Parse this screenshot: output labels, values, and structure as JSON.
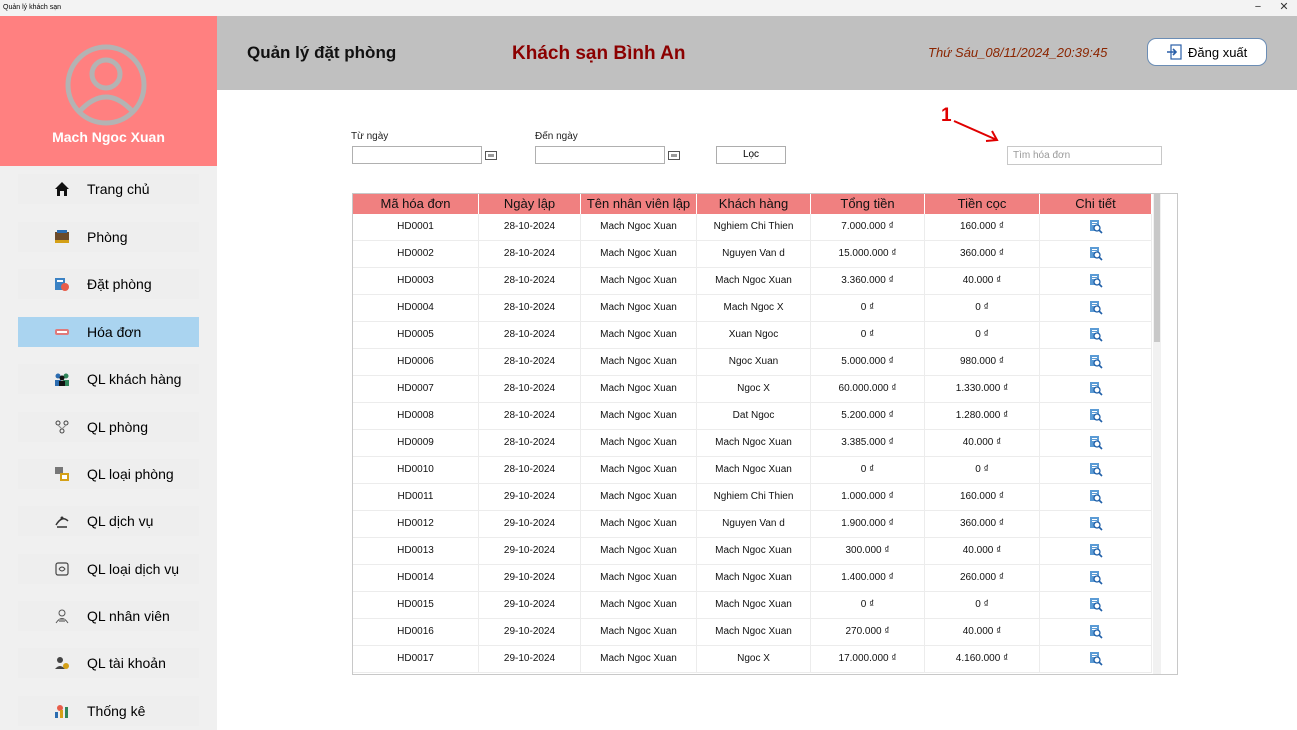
{
  "window": {
    "title": "Quản lý khách sạn",
    "minimize": "−",
    "close": "✕"
  },
  "sidebar": {
    "user_name": "Mach Ngoc Xuan",
    "items": [
      {
        "label": "Trang chủ",
        "icon": "home-icon"
      },
      {
        "label": "Phòng",
        "icon": "room-icon"
      },
      {
        "label": "Đặt phòng",
        "icon": "booking-icon"
      },
      {
        "label": "Hóa đơn",
        "icon": "invoice-icon",
        "active": true
      },
      {
        "label": "QL khách hàng",
        "icon": "customers-icon"
      },
      {
        "label": "QL phòng",
        "icon": "room-manage-icon"
      },
      {
        "label": "QL loại phòng",
        "icon": "room-type-icon"
      },
      {
        "label": "QL dịch vụ",
        "icon": "service-icon"
      },
      {
        "label": "QL loại dịch vụ",
        "icon": "service-type-icon"
      },
      {
        "label": "QL nhân viên",
        "icon": "staff-icon"
      },
      {
        "label": "QL tài khoản",
        "icon": "account-icon"
      },
      {
        "label": "Thống kê",
        "icon": "stats-icon"
      }
    ]
  },
  "header": {
    "title": "Quản lý đặt phòng",
    "hotel_name": "Khách sạn Bình An",
    "datetime": "Thứ Sáu_08/11/2024_20:39:45",
    "logout_label": "Đăng xuất"
  },
  "filter": {
    "from_label": "Từ ngày",
    "to_label": "Đến ngày",
    "from_value": "",
    "to_value": "",
    "filter_button": "Lọc",
    "search_placeholder": "Tìm hóa đơn",
    "annotation": "1"
  },
  "table": {
    "columns": [
      "Mã hóa đơn",
      "Ngày lập",
      "Tên nhân viên lập",
      "Khách hàng",
      "Tổng tiền",
      "Tiền cọc",
      "Chi tiết"
    ],
    "rows": [
      [
        "HD0001",
        "28-10-2024",
        "Mach Ngoc Xuan",
        "Nghiem Chi Thien",
        "7.000.000 ₫",
        "160.000 ₫"
      ],
      [
        "HD0002",
        "28-10-2024",
        "Mach Ngoc Xuan",
        "Nguyen Van d",
        "15.000.000 ₫",
        "360.000 ₫"
      ],
      [
        "HD0003",
        "28-10-2024",
        "Mach Ngoc Xuan",
        "Mach Ngoc Xuan",
        "3.360.000 ₫",
        "40.000 ₫"
      ],
      [
        "HD0004",
        "28-10-2024",
        "Mach Ngoc Xuan",
        "Mach Ngoc X",
        "0 ₫",
        "0 ₫"
      ],
      [
        "HD0005",
        "28-10-2024",
        "Mach Ngoc Xuan",
        "Xuan Ngoc",
        "0 ₫",
        "0 ₫"
      ],
      [
        "HD0006",
        "28-10-2024",
        "Mach Ngoc Xuan",
        "Ngoc Xuan",
        "5.000.000 ₫",
        "980.000 ₫"
      ],
      [
        "HD0007",
        "28-10-2024",
        "Mach Ngoc Xuan",
        "Ngoc X",
        "60.000.000 ₫",
        "1.330.000 ₫"
      ],
      [
        "HD0008",
        "28-10-2024",
        "Mach Ngoc Xuan",
        "Dat Ngoc",
        "5.200.000 ₫",
        "1.280.000 ₫"
      ],
      [
        "HD0009",
        "28-10-2024",
        "Mach Ngoc Xuan",
        "Mach Ngoc Xuan",
        "3.385.000 ₫",
        "40.000 ₫"
      ],
      [
        "HD0010",
        "28-10-2024",
        "Mach Ngoc Xuan",
        "Mach Ngoc Xuan",
        "0 ₫",
        "0 ₫"
      ],
      [
        "HD0011",
        "29-10-2024",
        "Mach Ngoc Xuan",
        "Nghiem Chi Thien",
        "1.000.000 ₫",
        "160.000 ₫"
      ],
      [
        "HD0012",
        "29-10-2024",
        "Mach Ngoc Xuan",
        "Nguyen Van d",
        "1.900.000 ₫",
        "360.000 ₫"
      ],
      [
        "HD0013",
        "29-10-2024",
        "Mach Ngoc Xuan",
        "Mach Ngoc Xuan",
        "300.000 ₫",
        "40.000 ₫"
      ],
      [
        "HD0014",
        "29-10-2024",
        "Mach Ngoc Xuan",
        "Mach Ngoc Xuan",
        "1.400.000 ₫",
        "260.000 ₫"
      ],
      [
        "HD0015",
        "29-10-2024",
        "Mach Ngoc Xuan",
        "Mach Ngoc Xuan",
        "0 ₫",
        "0 ₫"
      ],
      [
        "HD0016",
        "29-10-2024",
        "Mach Ngoc Xuan",
        "Mach Ngoc Xuan",
        "270.000 ₫",
        "40.000 ₫"
      ],
      [
        "HD0017",
        "29-10-2024",
        "Mach Ngoc Xuan",
        "Ngoc X",
        "17.000.000 ₫",
        "4.160.000 ₫"
      ]
    ]
  },
  "colors": {
    "profile_bg": "#ff8080",
    "active_menu": "#aad4f0",
    "header_bg": "#c0c0c0",
    "hotel_name": "#8b0000",
    "table_header": "#f08080"
  }
}
